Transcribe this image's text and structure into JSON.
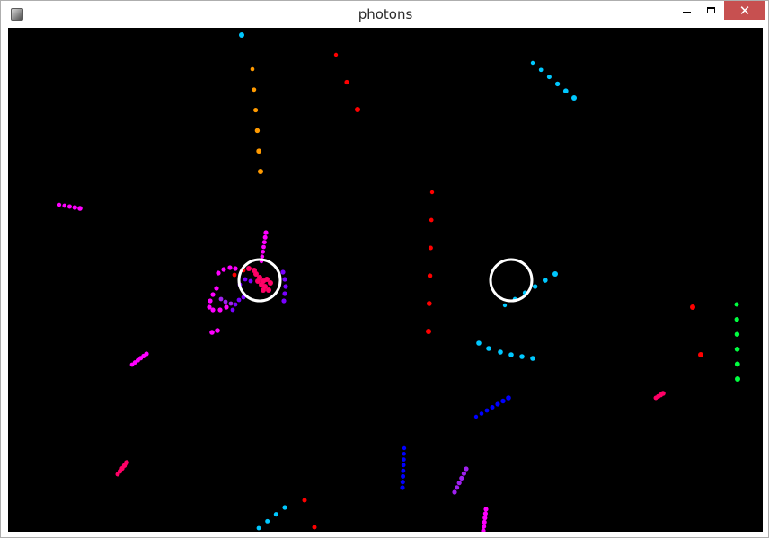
{
  "window": {
    "title": "photons",
    "icons": {
      "app": "app-icon",
      "minimize": "minimize-icon",
      "maximize": "maximize-icon",
      "close": "close-icon"
    },
    "close_glyph": "✕"
  },
  "scene": {
    "background": "#000000",
    "ring_color": "#ffffff",
    "colors": {
      "cyan": "#00c8ff",
      "orange": "#ff9a00",
      "red": "#ff0000",
      "magenta": "#ff00ff",
      "pink": "#ff0066",
      "purple": "#a020f0",
      "violet": "#7a00ff",
      "blue": "#0000ff",
      "green": "#00ff40"
    }
  }
}
